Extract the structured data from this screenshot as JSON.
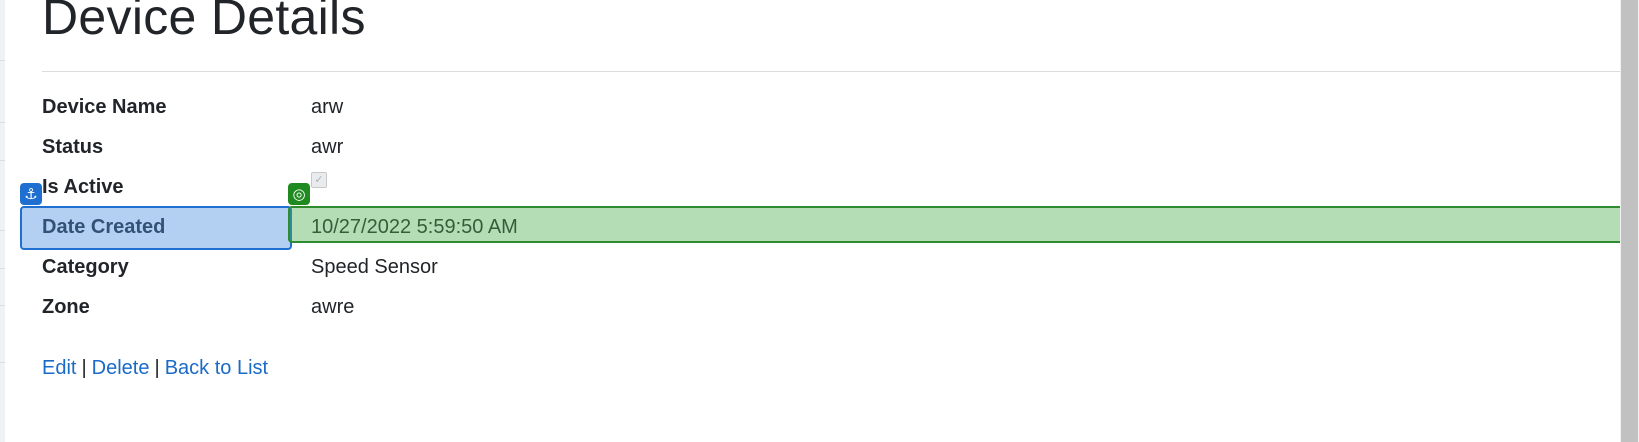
{
  "page": {
    "title": "Device Details"
  },
  "details": [
    {
      "label": "Device Name",
      "value": "arw"
    },
    {
      "label": "Status",
      "value": "awr"
    },
    {
      "label": "Is Active",
      "value": null,
      "checked": true
    },
    {
      "label": "Date Created",
      "value": "10/27/2022 5:59:50 AM"
    },
    {
      "label": "Category",
      "value": "Speed Sensor"
    },
    {
      "label": "Zone",
      "value": "awre"
    }
  ],
  "actions": {
    "edit": "Edit",
    "delete": "Delete",
    "back": "Back to List",
    "separator": "|"
  },
  "overlay": {
    "anchor_icon": "anchor-icon",
    "target_icon": "target-icon",
    "anchor_color": "#1f6fd1",
    "target_color": "#1f8a1f"
  }
}
